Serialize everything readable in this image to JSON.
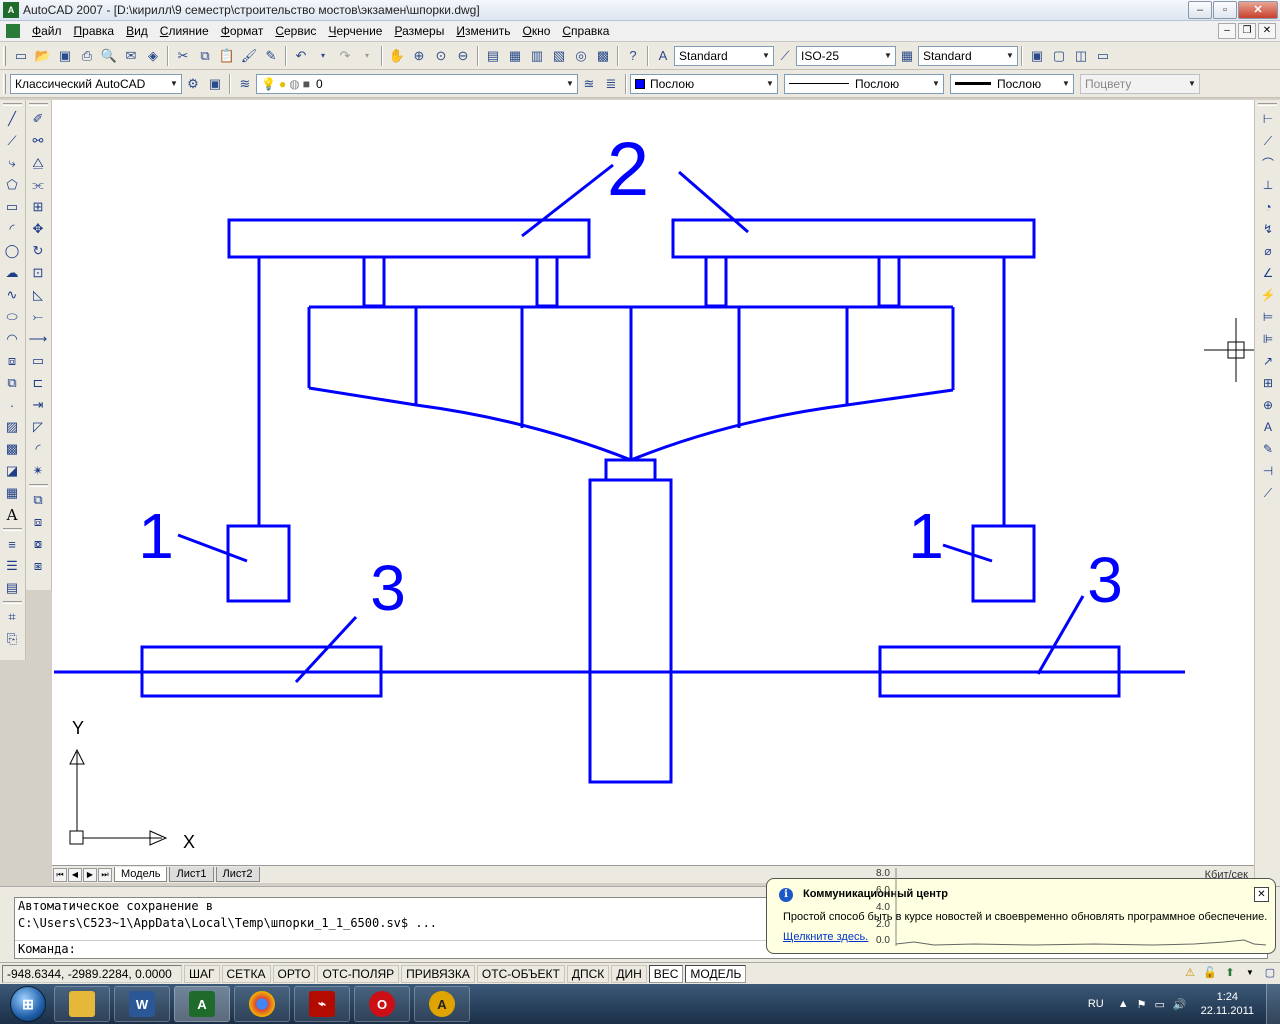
{
  "window": {
    "title": "AutoCAD 2007 - [D:\\кирилл\\9 семестр\\строительство мостов\\экзамен\\шпорки.dwg]",
    "logo_text": "A"
  },
  "menu": [
    "Файл",
    "Правка",
    "Вид",
    "Слияние",
    "Формат",
    "Сервис",
    "Черчение",
    "Размеры",
    "Изменить",
    "Окно",
    "Справка"
  ],
  "toolbar1": {
    "text_style": "Standard",
    "dim_style": "ISO-25",
    "table_style": "Standard"
  },
  "toolbar2": {
    "workspace": "Классический AutoCAD",
    "layer": "0",
    "color": "Послою",
    "linetype": "Послою",
    "lineweight": "Послою",
    "plot_style": "Поцвету",
    "colors": {
      "bylayer": "#0000ff"
    }
  },
  "drawing": {
    "labels": {
      "l2": "2",
      "l1a": "1",
      "l1b": "1",
      "l3a": "3",
      "l3b": "3",
      "ucs_y": "Y",
      "ucs_x": "X"
    },
    "line_color": "#0000ff"
  },
  "tabs": [
    "Модель",
    "Лист1",
    "Лист2"
  ],
  "speed_label": "Кбит/сек",
  "command": {
    "line1": "Автоматическое сохранение в",
    "line2": "C:\\Users\\C523~1\\AppData\\Local\\Temp\\шпорки_1_1_6500.sv$ ...",
    "prompt": "Команда:"
  },
  "status": {
    "coords": "-948.6344,  -2989.2284, 0.0000",
    "buttons": [
      {
        "label": "ШАГ",
        "on": false
      },
      {
        "label": "СЕТКА",
        "on": false
      },
      {
        "label": "ОРТО",
        "on": false
      },
      {
        "label": "ОТС-ПОЛЯР",
        "on": false
      },
      {
        "label": "ПРИВЯЗКА",
        "on": false
      },
      {
        "label": "ОТС-ОБЪЕКТ",
        "on": false
      },
      {
        "label": "ДПСК",
        "on": false
      },
      {
        "label": "ДИН",
        "on": false
      },
      {
        "label": "ВЕС",
        "on": true
      },
      {
        "label": "МОДЕЛЬ",
        "on": true
      }
    ]
  },
  "balloon": {
    "title": "Коммуникационный центр",
    "text": "Простой способ быть в курсе новостей и своевременно обновлять программное обеспечение.",
    "link": "Щелкните здесь.",
    "graph_ticks": [
      "8.0",
      "6.0",
      "4.0",
      "2.0",
      "0.0"
    ]
  },
  "taskbar": {
    "lang": "RU",
    "time": "1:24",
    "date": "22.11.2011",
    "apps": [
      {
        "name": "explorer",
        "glyph": "",
        "color": "#e5b83a"
      },
      {
        "name": "word",
        "glyph": "W",
        "color": "#2b5797"
      },
      {
        "name": "autocad",
        "glyph": "A",
        "color": "#1f6b2b"
      },
      {
        "name": "chrome",
        "glyph": "",
        "color": "#db4437"
      },
      {
        "name": "acrobat",
        "glyph": "",
        "color": "#b30b00"
      },
      {
        "name": "opera",
        "glyph": "O",
        "color": "#cc0f16"
      },
      {
        "name": "autocad-alt",
        "glyph": "A",
        "color": "#e0a400"
      }
    ]
  }
}
